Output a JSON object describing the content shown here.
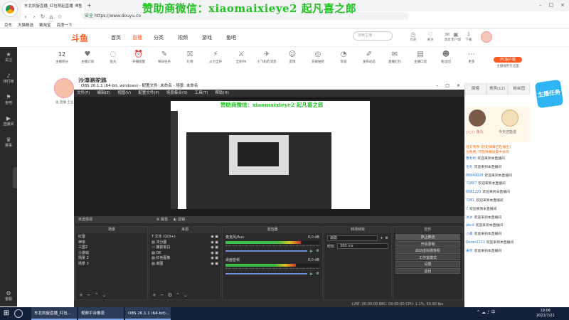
{
  "browser": {
    "tab_title": "东北凯旋直播_红包赞起直播 斗鱼",
    "tab_close": "×",
    "new_tab": "+",
    "secure_label": "安全",
    "url": "https://www.douyu.co",
    "nav_back": "‹",
    "nav_forward": "›",
    "nav_reload": "↻",
    "nav_home": "⌂",
    "nav_star": "☆",
    "window_controls": [
      "–",
      "□",
      "×"
    ],
    "bookmarks": [
      "京东",
      "天猫精选",
      "聚淘宝",
      "百度一下"
    ]
  },
  "overlay": {
    "banner": "赞助商微信：xiaomaixieye2    起凡喜之郎"
  },
  "left_sidebar": {
    "items": [
      {
        "icon": "★",
        "label": "关注"
      },
      {
        "icon": "♪",
        "label": "排行榜"
      },
      {
        "icon": "⚑",
        "label": "鱼吧"
      },
      {
        "icon": "▶",
        "label": "直播间"
      },
      {
        "icon": "♛",
        "label": "赛事"
      }
    ],
    "bottom": {
      "icon": "⚙",
      "label": "客服"
    }
  },
  "douyu_header": {
    "logo": "斗鱼",
    "nav": [
      "首页",
      "直播",
      "分类",
      "视频",
      "游戏",
      "鱼吧"
    ],
    "search_placeholder": "搜索主播",
    "top_icons": [
      "历史",
      "关注",
      "消息",
      "客户端",
      "下载"
    ]
  },
  "follow_bar": {
    "count": "12",
    "count_label": "主播积分",
    "items": [
      "主播订阅",
      "鱼丸",
      "开播提醒",
      "每日任务",
      "礼物",
      "火力全开",
      "全民PK",
      "小飞机的消息",
      "友情",
      "充能抽奖",
      "等级",
      "发布动态",
      "直播红包",
      "主播口袋",
      "粉丝团",
      "更多"
    ],
    "pc_button": "PC客户端",
    "pc_sub": "主播福利在这里"
  },
  "streamer": {
    "name": "沙漠骆驼路",
    "sub": "舍 直播 土豆 关注"
  },
  "right_panel": {
    "tabs": [
      "周榜",
      "贵宾(12)",
      "粉丝团"
    ],
    "badge": "主播任务",
    "gift_user": "○○○ 鱼丸",
    "gift_user2": "今天还能送",
    "chat_header": "社交有序 (历史弹幕已在播出)",
    "chat_sub": "为免费, 可在弹幕设置中关闭",
    "chat": [
      {
        "user": "鲁利利",
        "text": "欢迎来到本直播间"
      },
      {
        "user": "毛毛",
        "text": "欢迎来到本直播间"
      },
      {
        "user": "86649028",
        "text": "欢迎来到本直播间"
      },
      {
        "user": "71887",
        "text": "欢迎来到本直播间"
      },
      {
        "user": "6081220",
        "text": "欢迎来到本直播间"
      },
      {
        "user": "7281",
        "text": "欢迎来到本直播间"
      },
      {
        "user": "7",
        "text": "欢迎来到本直播间"
      },
      {
        "user": "冰冰",
        "text": "欢迎来到本直播间"
      },
      {
        "user": "abcd",
        "text": "欢迎来到本直播间"
      },
      {
        "user": "小美",
        "text": "欢迎来到本直播间"
      },
      {
        "user": "Doner1111",
        "text": "欢迎来到本直播间"
      },
      {
        "user": "果然",
        "text": "欢迎来到本直播间"
      }
    ]
  },
  "obs": {
    "title": "OBS 26.1.1 (64-bit, windows) - 配置文件: 未命名 - 场景: 未命名",
    "menu": [
      "文件(F)",
      "编辑(E)",
      "视图(V)",
      "配置文件(P)",
      "场景集合(S)",
      "工具(T)",
      "帮助(H)"
    ],
    "strip_left": "未选择源",
    "strip_props": "属性",
    "strip_filters": "滤镜",
    "docks": {
      "scenes": {
        "title": "场景",
        "items": [
          "红警",
          "神单",
          "三国2",
          "小游戏",
          "场景 2",
          "场景 3"
        ]
      },
      "sources": {
        "title": "来源",
        "items": [
          "文本 (GDI+)",
          "冲分图",
          "捕获窗口",
          "OK",
          "红色图像",
          "底图"
        ]
      },
      "mixer": {
        "title": "混音器",
        "channels": [
          {
            "name": "麦克风/Aux",
            "db": "0.0 dB",
            "level": 0.8
          },
          {
            "name": "桌面音频",
            "db": "0.0 dB",
            "level": 0.75
          }
        ]
      },
      "transitions": {
        "title": "转场特效",
        "type": "渐隐",
        "duration_label": "时长",
        "duration": "300 ms"
      },
      "controls": {
        "title": "控件",
        "buttons": [
          "停止推流",
          "开始录制",
          "启动虚拟摄像机",
          "工作室模式",
          "设置",
          "退出"
        ]
      }
    },
    "status": "LIVE: 00:00:00   REC: 00:00:00   CPU: 1.1%, 60.00 fps"
  },
  "taskbar": {
    "start": "⊞",
    "items": [
      "东北凯旋直播_红包...",
      "视频平台推流",
      "OBS 26.1.1 (64-bit)..."
    ],
    "tray": "^ ☁ ♪ 中",
    "time": "19:06",
    "date": "2021/7/21"
  }
}
